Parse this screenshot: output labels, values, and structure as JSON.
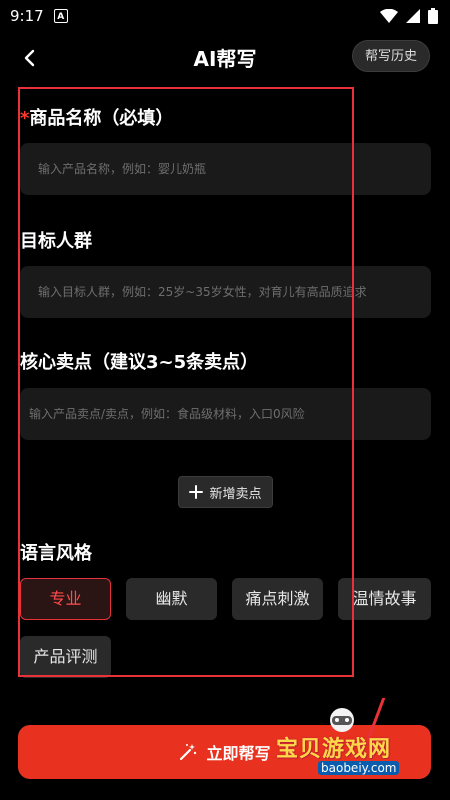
{
  "status": {
    "time": "9:17",
    "notif": "A"
  },
  "header": {
    "title": "AI帮写",
    "history_label": "帮写历史"
  },
  "form": {
    "product_name": {
      "required_mark": "*",
      "label": "商品名称（必填）",
      "placeholder": "输入产品名称，例如：婴儿奶瓶"
    },
    "audience": {
      "label": "目标人群",
      "placeholder": "输入目标人群，例如：25岁~35岁女性，对育儿有高品质追求"
    },
    "selling_points": {
      "label": "核心卖点（建议3~5条卖点）",
      "placeholder": "输入产品卖点/卖点，例如：食品级材料，入口0风险"
    },
    "add_point_label": "新增卖点",
    "style": {
      "label": "语言风格",
      "options": [
        "专业",
        "幽默",
        "痛点刺激",
        "温情故事",
        "产品评测"
      ],
      "selected": "专业"
    }
  },
  "action": {
    "generate_label": "立即帮写"
  },
  "watermark": {
    "text": "宝贝游戏网",
    "url": "baobeiy.com"
  },
  "colors": {
    "accent": "#e8321f",
    "highlight": "#e8323a",
    "field_bg": "#1a1a1a",
    "chip_bg": "#2a2a2a"
  }
}
